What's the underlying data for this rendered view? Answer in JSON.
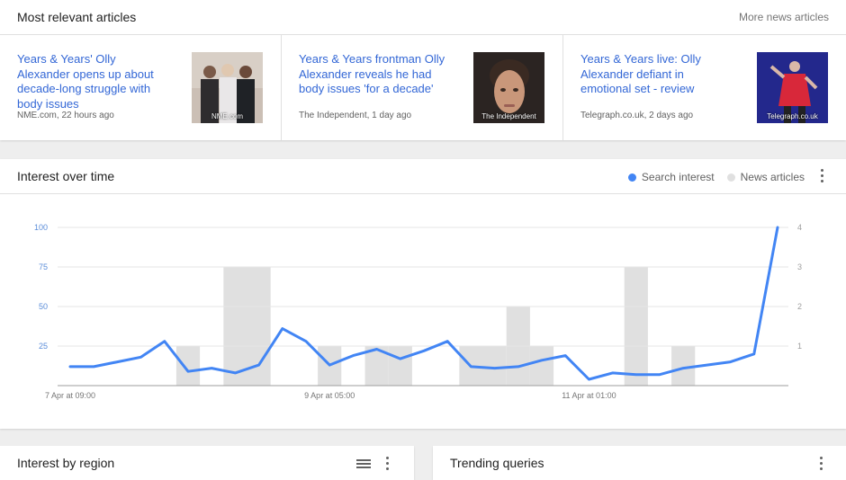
{
  "articles": {
    "title": "Most relevant articles",
    "more_link": "More news articles",
    "items": [
      {
        "title": "Years & Years' Olly Alexander opens up about decade-long struggle with body issues",
        "meta": "NME.com, 22 hours ago",
        "thumb_caption": "NME.com"
      },
      {
        "title": "Years & Years frontman Olly Alexander reveals he had body issues 'for a decade'",
        "meta": "The Independent, 1 day ago",
        "thumb_caption": "The Independent"
      },
      {
        "title": "Years & Years live: Olly Alexander defiant in emotional set - review",
        "meta": "Telegraph.co.uk, 2 days ago",
        "thumb_caption": "Telegraph.co.uk"
      }
    ]
  },
  "interest_over_time": {
    "title": "Interest over time",
    "legend": {
      "search": "Search interest",
      "news": "News articles"
    },
    "colors": {
      "search": "#4285f4",
      "news": "#e0e0e0"
    }
  },
  "chart_data": {
    "type": "line",
    "x_tick_labels": [
      "7 Apr at 09:00",
      "9 Apr at 05:00",
      "11 Apr at 01:00"
    ],
    "y_left_ticks": [
      25,
      50,
      75,
      100
    ],
    "y_right_ticks": [
      1,
      2,
      3,
      4
    ],
    "ylim_left": [
      0,
      100
    ],
    "ylim_right": [
      0,
      4
    ],
    "series": [
      {
        "name": "Search interest",
        "axis": "left",
        "values": [
          12,
          12,
          15,
          18,
          28,
          9,
          11,
          8,
          13,
          36,
          28,
          13,
          19,
          23,
          17,
          22,
          28,
          12,
          11,
          12,
          16,
          19,
          4,
          8,
          7,
          7,
          11,
          13,
          15,
          20,
          100
        ]
      },
      {
        "name": "News articles",
        "axis": "right",
        "values": [
          0,
          0,
          0,
          0,
          0,
          1,
          0,
          3,
          3,
          0,
          0,
          1,
          0,
          1,
          1,
          0,
          0,
          1,
          1,
          2,
          1,
          0,
          0,
          0,
          3,
          0,
          1,
          0,
          0,
          0,
          0
        ]
      }
    ]
  },
  "region": {
    "title": "Interest by region"
  },
  "trending": {
    "title": "Trending queries"
  }
}
